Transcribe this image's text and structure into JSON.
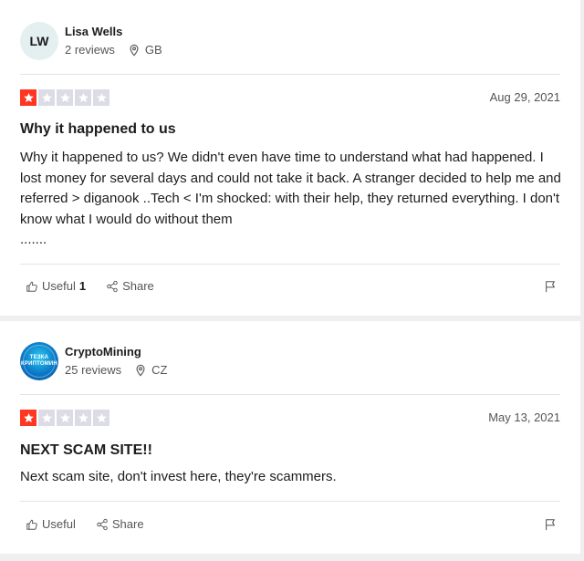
{
  "reviews": [
    {
      "initials": "LW",
      "name": "Lisa Wells",
      "review_count": "2 reviews",
      "country": "GB",
      "rating": 1,
      "max_rating": 5,
      "date": "Aug 29, 2021",
      "title": "Why it happened to us",
      "body": "Why it happened to us? We didn't even have time to understand what had happened. I lost money for several days and could not take it back. A stranger decided to help me and referred > diganook ..Tech < I'm shocked: with their help, they returned everything. I don't know what I would do without them",
      "body_tail": ".......",
      "useful_label": "Useful",
      "useful_count": "1",
      "share_label": "Share"
    },
    {
      "avatar_text": "ТЕЗКА КРИПТОМИН",
      "name": "CryptoMining",
      "review_count": "25 reviews",
      "country": "CZ",
      "rating": 1,
      "max_rating": 5,
      "date": "May 13, 2021",
      "title": "NEXT SCAM SITE!!",
      "body": "Next scam site, don't invest here, they're scammers.",
      "useful_label": "Useful",
      "share_label": "Share"
    }
  ],
  "colors": {
    "star_on": "#ff3722",
    "star_off": "#dcdce6",
    "avatar_bg": "#e4efef"
  },
  "icons": {
    "location": "map-pin-icon",
    "useful": "thumbs-up-icon",
    "share": "share-icon",
    "report": "flag-icon",
    "star": "star-icon"
  }
}
